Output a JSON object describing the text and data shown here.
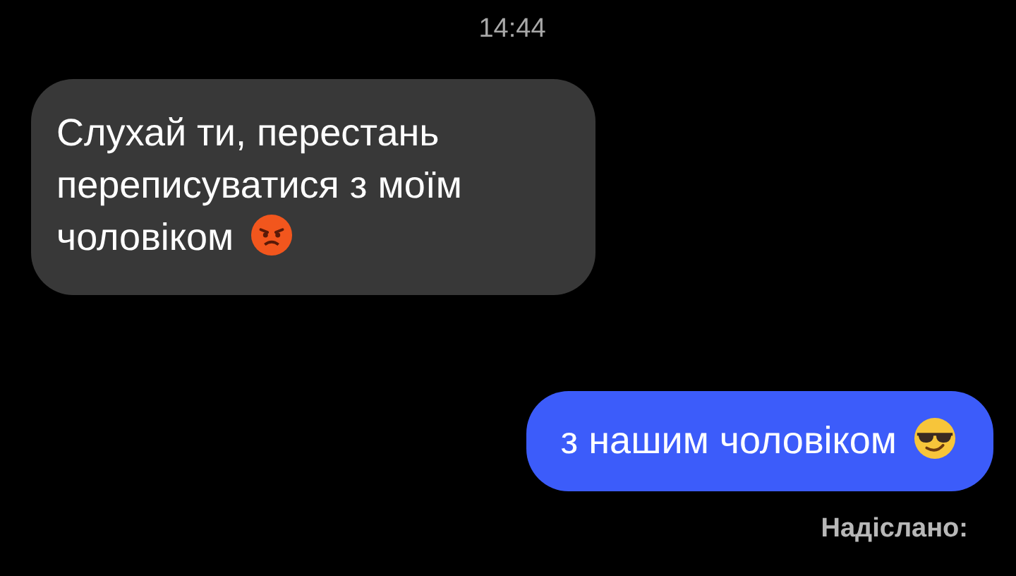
{
  "time": "14:44",
  "messages": [
    {
      "kind": "incoming",
      "text": "Слухай ти, перестань переписуватися з моїм чоловіком",
      "emoji": {
        "kind": "angry"
      }
    },
    {
      "kind": "outgoing",
      "text": "з нашим чоловіком",
      "emoji": {
        "kind": "cool"
      }
    }
  ],
  "status": "Надіслано:"
}
